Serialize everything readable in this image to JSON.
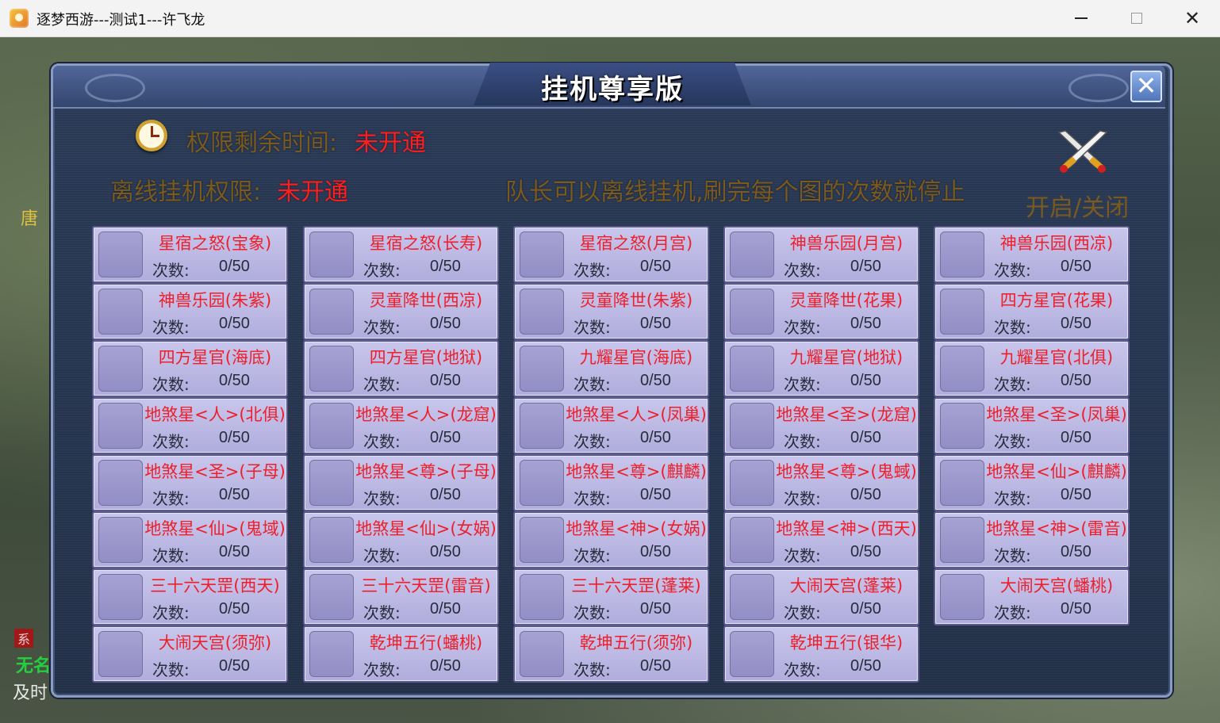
{
  "window": {
    "title": "逐梦西游---测试1---许飞龙"
  },
  "background": {
    "left_text_1": "唐",
    "left_badge": "系",
    "left_text_2": "无名",
    "left_text_3": "及时"
  },
  "dialog": {
    "title": "挂机尊享版",
    "close_label": "✕",
    "remaining_time_label": "权限剩余时间:",
    "remaining_time_value": "未开通",
    "offline_label": "离线挂机权限:",
    "offline_value": "未开通",
    "notice": "队长可以离线挂机,刷完每个图的次数就停止",
    "toggle_label": "开启/关闭",
    "count_label": "次数:",
    "columns": [
      [
        {
          "name": "星宿之怒(宝象)",
          "count": "0/50"
        },
        {
          "name": "神兽乐园(朱紫)",
          "count": "0/50"
        },
        {
          "name": "四方星官(海底)",
          "count": "0/50"
        },
        {
          "name": "地煞星<人>(北俱)",
          "count": "0/50"
        },
        {
          "name": "地煞星<圣>(子母)",
          "count": "0/50"
        },
        {
          "name": "地煞星<仙>(鬼域)",
          "count": "0/50"
        },
        {
          "name": "三十六天罡(西天)",
          "count": "0/50"
        },
        {
          "name": "大闹天宫(须弥)",
          "count": "0/50"
        }
      ],
      [
        {
          "name": "星宿之怒(长寿)",
          "count": "0/50"
        },
        {
          "name": "灵童降世(西凉)",
          "count": "0/50"
        },
        {
          "name": "四方星官(地狱)",
          "count": "0/50"
        },
        {
          "name": "地煞星<人>(龙窟)",
          "count": "0/50"
        },
        {
          "name": "地煞星<尊>(子母)",
          "count": "0/50"
        },
        {
          "name": "地煞星<仙>(女娲)",
          "count": "0/50"
        },
        {
          "name": "三十六天罡(雷音)",
          "count": "0/50"
        },
        {
          "name": "乾坤五行(蟠桃)",
          "count": "0/50"
        }
      ],
      [
        {
          "name": "星宿之怒(月宫)",
          "count": "0/50"
        },
        {
          "name": "灵童降世(朱紫)",
          "count": "0/50"
        },
        {
          "name": "九耀星官(海底)",
          "count": "0/50"
        },
        {
          "name": "地煞星<人>(凤巢)",
          "count": "0/50"
        },
        {
          "name": "地煞星<尊>(麒麟)",
          "count": "0/50"
        },
        {
          "name": "地煞星<神>(女娲)",
          "count": "0/50"
        },
        {
          "name": "三十六天罡(蓬莱)",
          "count": "0/50"
        },
        {
          "name": "乾坤五行(须弥)",
          "count": "0/50"
        }
      ],
      [
        {
          "name": "神兽乐园(月宫)",
          "count": "0/50"
        },
        {
          "name": "灵童降世(花果)",
          "count": "0/50"
        },
        {
          "name": "九耀星官(地狱)",
          "count": "0/50"
        },
        {
          "name": "地煞星<圣>(龙窟)",
          "count": "0/50"
        },
        {
          "name": "地煞星<尊>(鬼蜮)",
          "count": "0/50"
        },
        {
          "name": "地煞星<神>(西天)",
          "count": "0/50"
        },
        {
          "name": "大闹天宫(蓬莱)",
          "count": "0/50"
        },
        {
          "name": "乾坤五行(银华)",
          "count": "0/50"
        }
      ],
      [
        {
          "name": "神兽乐园(西凉)",
          "count": "0/50"
        },
        {
          "name": "四方星官(花果)",
          "count": "0/50"
        },
        {
          "name": "九耀星官(北俱)",
          "count": "0/50"
        },
        {
          "name": "地煞星<圣>(凤巢)",
          "count": "0/50"
        },
        {
          "name": "地煞星<仙>(麒麟)",
          "count": "0/50"
        },
        {
          "name": "地煞星<神>(雷音)",
          "count": "0/50"
        },
        {
          "name": "大闹天宫(蟠桃)",
          "count": "0/50"
        }
      ]
    ]
  }
}
